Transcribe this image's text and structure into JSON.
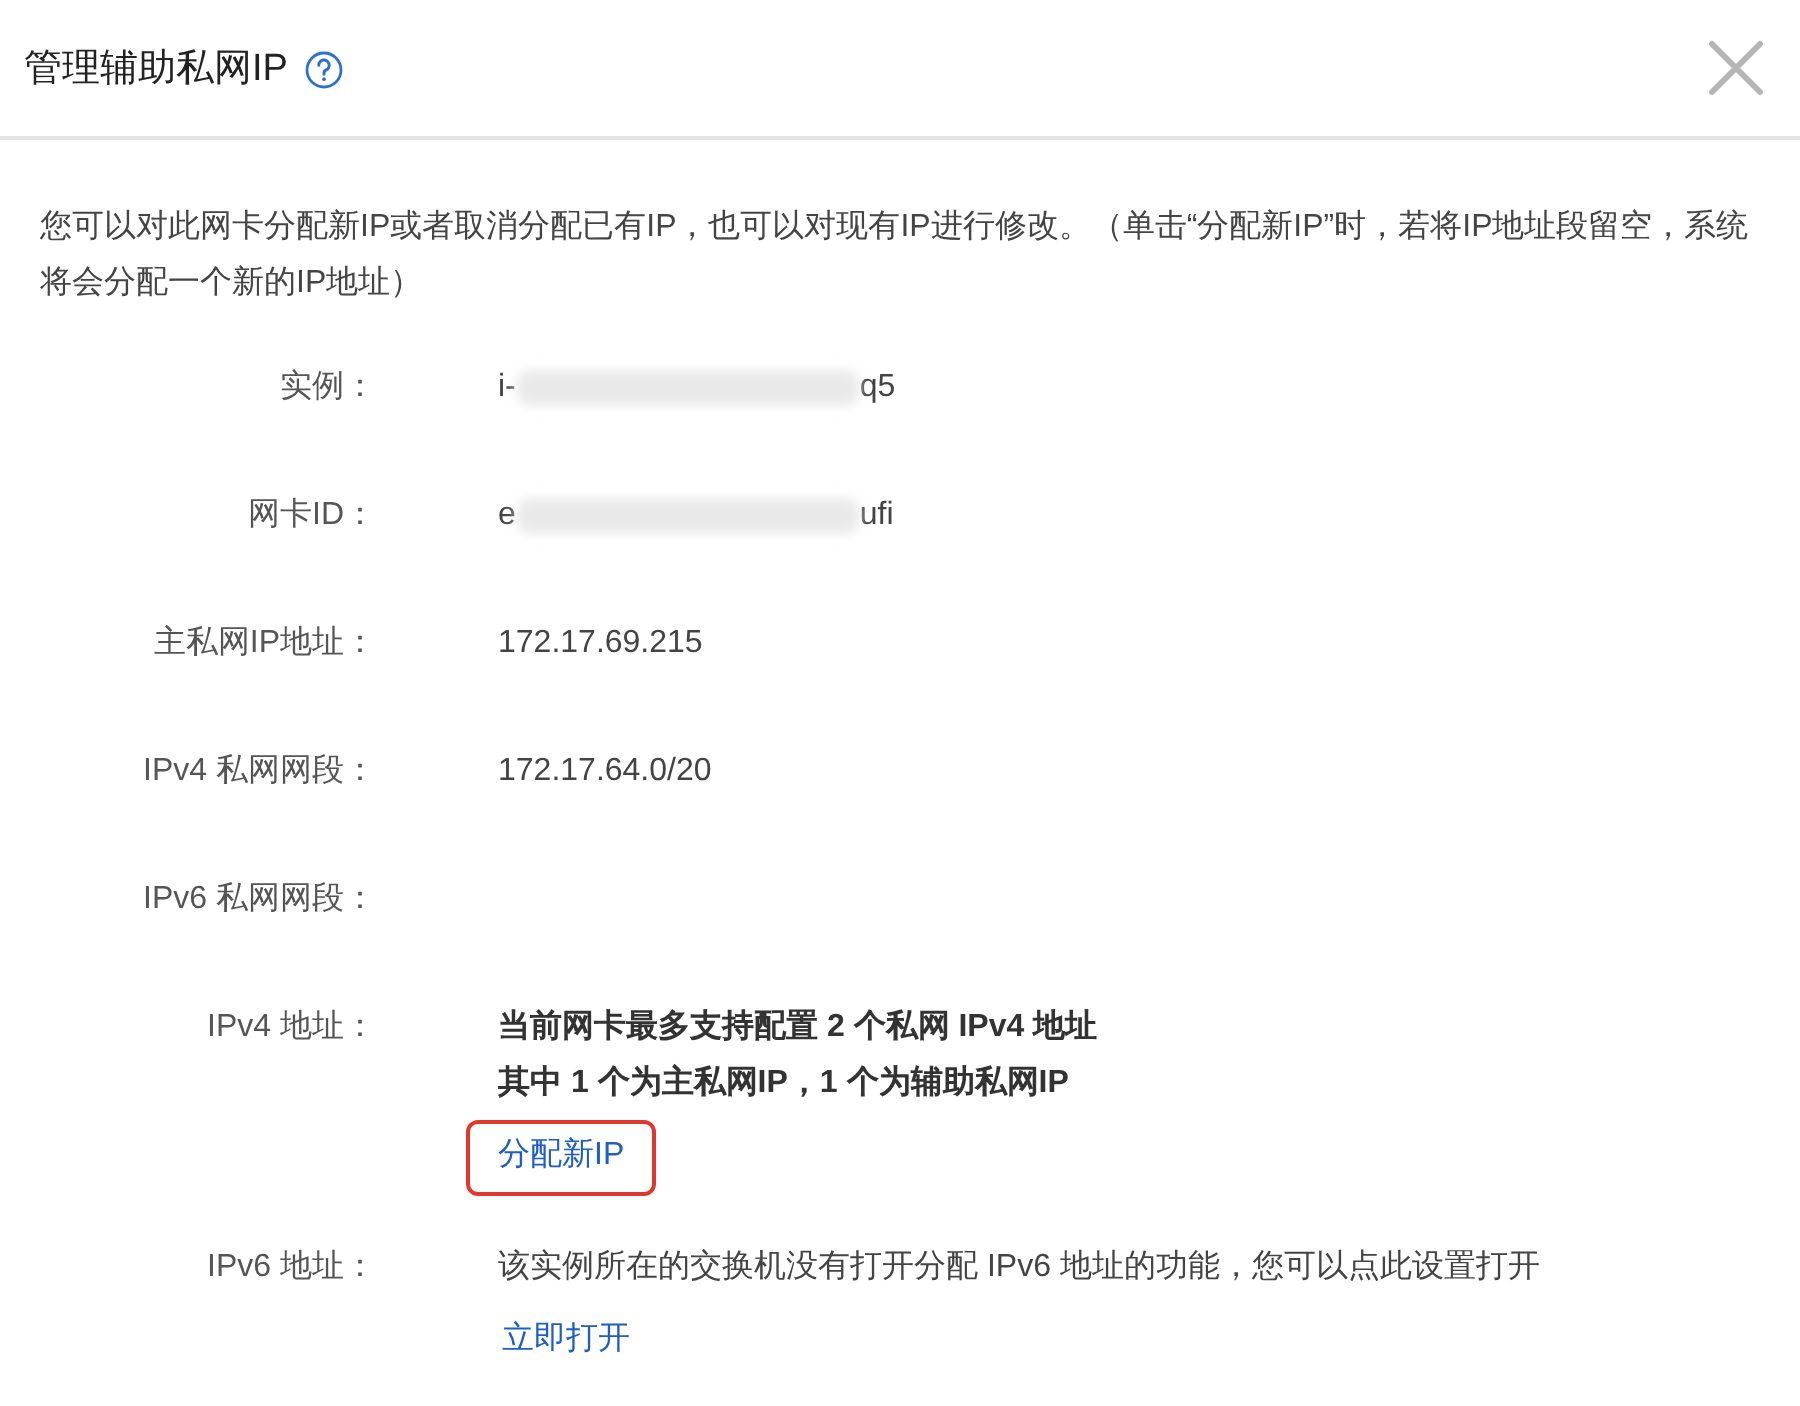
{
  "dialog": {
    "title": "管理辅助私网IP"
  },
  "intro": "您可以对此网卡分配新IP或者取消分配已有IP，也可以对现有IP进行修改。（单击“分配新IP”时，若将IP地址段留空，系统将会分配一个新的IP地址）",
  "rows": [
    {
      "kind": "redacted",
      "label": "实例：",
      "value_prefix": "i-",
      "value_suffix": "q5"
    },
    {
      "kind": "redacted",
      "label": "网卡ID：",
      "value_prefix": "e",
      "value_suffix": "ufi"
    },
    {
      "kind": "text",
      "label": "主私网IP地址：",
      "value": "172.17.69.215"
    },
    {
      "kind": "text",
      "label": "IPv4 私网网段：",
      "value": "172.17.64.0/20"
    },
    {
      "kind": "empty",
      "label": "IPv6 私网网段："
    },
    {
      "kind": "notice",
      "label": "IPv4 地址：",
      "lines": [
        "当前网卡最多支持配置 2 个私网 IPv4 地址",
        "其中 1 个为主私网IP，1 个为辅助私网IP"
      ],
      "link": {
        "label": "分配新IP",
        "highlighted": true
      }
    },
    {
      "kind": "note",
      "label": "IPv6 地址：",
      "value": "该实例所在的交换机没有打开分配 IPv6 地址的功能，您可以点此设置打开",
      "link": {
        "label": "立即打开",
        "highlighted": false
      }
    }
  ]
}
